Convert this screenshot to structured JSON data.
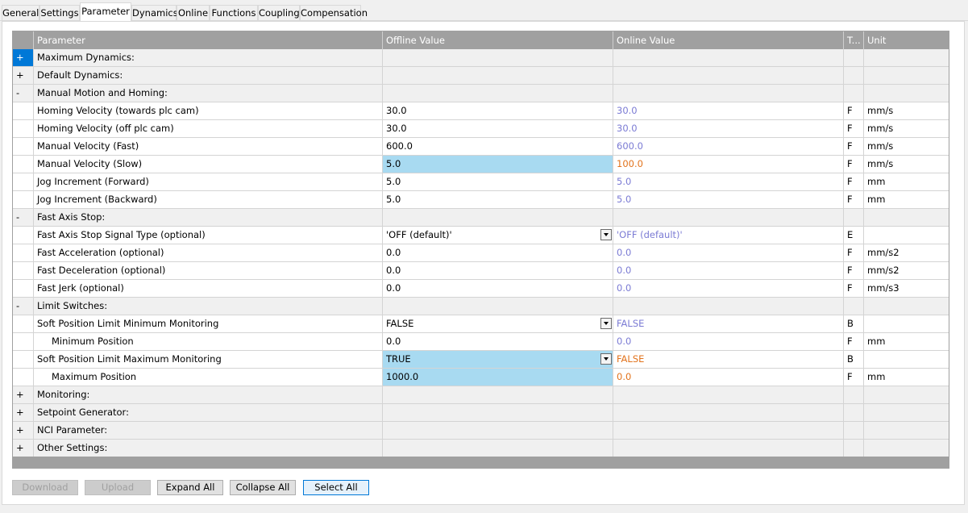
{
  "tabs": [
    {
      "label": "General",
      "active": false
    },
    {
      "label": "Settings",
      "active": false
    },
    {
      "label": "Parameter",
      "active": true
    },
    {
      "label": "Dynamics",
      "active": false
    },
    {
      "label": "Online",
      "active": false
    },
    {
      "label": "Functions",
      "active": false
    },
    {
      "label": "Coupling",
      "active": false
    },
    {
      "label": "Compensation",
      "active": false
    }
  ],
  "grid": {
    "columns": {
      "parameter": "Parameter",
      "offline": "Offline Value",
      "online": "Online Value",
      "type": "T...",
      "unit": "Unit"
    },
    "rows": [
      {
        "kind": "group",
        "toggle": "+",
        "name": "Maximum Dynamics:",
        "selected": true
      },
      {
        "kind": "group",
        "toggle": "+",
        "name": "Default Dynamics:"
      },
      {
        "kind": "group",
        "toggle": "-",
        "name": "Manual Motion and Homing:"
      },
      {
        "kind": "param",
        "name": "Homing Velocity (towards plc cam)",
        "offline": "30.0",
        "online": "30.0",
        "type": "F",
        "unit": "mm/s"
      },
      {
        "kind": "param",
        "name": "Homing Velocity (off plc cam)",
        "offline": "30.0",
        "online": "30.0",
        "type": "F",
        "unit": "mm/s"
      },
      {
        "kind": "param",
        "name": "Manual Velocity (Fast)",
        "offline": "600.0",
        "online": "600.0",
        "type": "F",
        "unit": "mm/s"
      },
      {
        "kind": "param",
        "name": "Manual Velocity (Slow)",
        "offline": "5.0",
        "online": "100.0",
        "type": "F",
        "unit": "mm/s",
        "highlight": true,
        "diff": true
      },
      {
        "kind": "param",
        "name": "Jog Increment (Forward)",
        "offline": "5.0",
        "online": "5.0",
        "type": "F",
        "unit": "mm"
      },
      {
        "kind": "param",
        "name": "Jog Increment (Backward)",
        "offline": "5.0",
        "online": "5.0",
        "type": "F",
        "unit": "mm"
      },
      {
        "kind": "group",
        "toggle": "-",
        "name": "Fast Axis Stop:"
      },
      {
        "kind": "param",
        "name": "Fast Axis Stop Signal Type (optional)",
        "offline": "'OFF (default)'",
        "online": "'OFF (default)'",
        "type": "E",
        "unit": "",
        "dropdown": true
      },
      {
        "kind": "param",
        "name": "Fast Acceleration (optional)",
        "offline": "0.0",
        "online": "0.0",
        "type": "F",
        "unit": "mm/s2"
      },
      {
        "kind": "param",
        "name": "Fast Deceleration (optional)",
        "offline": "0.0",
        "online": "0.0",
        "type": "F",
        "unit": "mm/s2"
      },
      {
        "kind": "param",
        "name": "Fast Jerk (optional)",
        "offline": "0.0",
        "online": "0.0",
        "type": "F",
        "unit": "mm/s3"
      },
      {
        "kind": "group",
        "toggle": "-",
        "name": "Limit Switches:"
      },
      {
        "kind": "param",
        "name": "Soft Position Limit Minimum Monitoring",
        "offline": "FALSE",
        "online": "FALSE",
        "type": "B",
        "unit": "",
        "dropdown": true
      },
      {
        "kind": "param",
        "name": "Minimum Position",
        "offline": "0.0",
        "online": "0.0",
        "type": "F",
        "unit": "mm",
        "indent": true
      },
      {
        "kind": "param",
        "name": "Soft Position Limit Maximum Monitoring",
        "offline": "TRUE",
        "online": "FALSE",
        "type": "B",
        "unit": "",
        "dropdown": true,
        "highlight": true,
        "diff": true
      },
      {
        "kind": "param",
        "name": "Maximum Position",
        "offline": "1000.0",
        "online": "0.0",
        "type": "F",
        "unit": "mm",
        "indent": true,
        "highlight": true,
        "diff": true
      },
      {
        "kind": "group",
        "toggle": "+",
        "name": "Monitoring:"
      },
      {
        "kind": "group",
        "toggle": "+",
        "name": "Setpoint Generator:"
      },
      {
        "kind": "group",
        "toggle": "+",
        "name": "NCI Parameter:"
      },
      {
        "kind": "group",
        "toggle": "+",
        "name": "Other Settings:"
      }
    ]
  },
  "buttons": {
    "download": "Download",
    "upload": "Upload",
    "expand_all": "Expand All",
    "collapse_all": "Collapse All",
    "select_all": "Select All"
  },
  "colors": {
    "selection": "#0078d7",
    "highlight": "#a8daf1",
    "online_value": "#7b7bd4",
    "online_diff": "#e2731c",
    "header": "#a0a0a0"
  }
}
